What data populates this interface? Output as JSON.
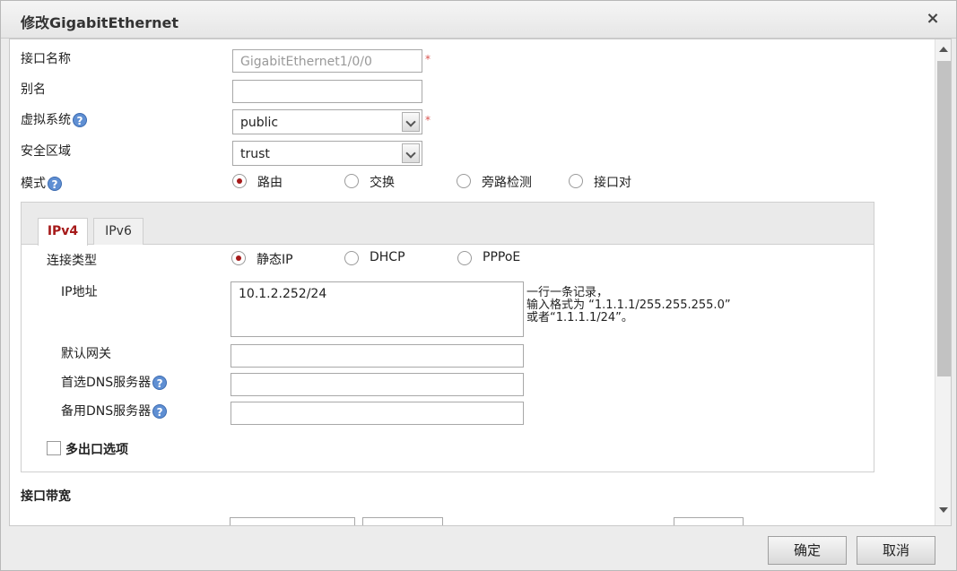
{
  "dialog": {
    "title": "修改GigabitEthernet",
    "close_label": "×"
  },
  "form": {
    "interface_name": {
      "label": "接口名称",
      "value": "GigabitEthernet1/0/0",
      "required_mark": "*"
    },
    "alias": {
      "label": "别名",
      "value": ""
    },
    "virtual_system": {
      "label": "虚拟系统",
      "value": "public",
      "required_mark": "*",
      "help": "?"
    },
    "security_zone": {
      "label": "安全区域",
      "value": "trust"
    },
    "mode": {
      "label": "模式",
      "help": "?",
      "options": [
        "路由",
        "交换",
        "旁路检测",
        "接口对"
      ],
      "selected": "路由"
    }
  },
  "tabs": {
    "ipv4": "IPv4",
    "ipv6": "IPv6",
    "active": "IPv4"
  },
  "ipv4": {
    "connection_type": {
      "label": "连接类型",
      "options": [
        "静态IP",
        "DHCP",
        "PPPoE"
      ],
      "selected": "静态IP"
    },
    "ip_address": {
      "label": "IP地址",
      "value": "10.1.2.252/24",
      "hint_line1": "一行一条记录，",
      "hint_line2": "输入格式为 “1.1.1.1/255.255.255.0”",
      "hint_line3": "或者“1.1.1.1/24”。"
    },
    "default_gateway": {
      "label": "默认网关",
      "value": ""
    },
    "primary_dns": {
      "label": "首选DNS服务器",
      "value": "",
      "help": "?"
    },
    "secondary_dns": {
      "label": "备用DNS服务器",
      "value": "",
      "help": "?"
    },
    "multi_egress": {
      "label": "多出口选项",
      "checked": false
    }
  },
  "bandwidth": {
    "section_title": "接口带宽"
  },
  "footer": {
    "ok": "确定",
    "cancel": "取消"
  },
  "colors": {
    "accent": "#a61a1a",
    "help_icon": "#5f8fd3",
    "required": "#d9534f"
  }
}
